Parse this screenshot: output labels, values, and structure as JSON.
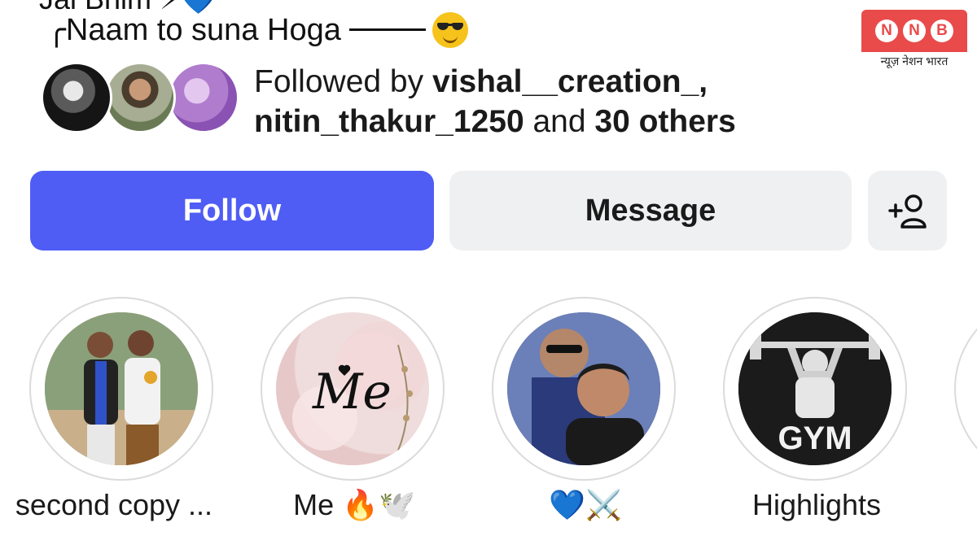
{
  "profile": {
    "bio_line_cut": "Jai Bhim ⚡💙",
    "bio_line": "╭Naam to suna Hoga",
    "followed_prefix": "Followed by ",
    "followed_user1": "vishal__creation_,",
    "followed_user2": "nitin_thakur_1250",
    "followed_and": " and ",
    "followed_others": "30 others"
  },
  "actions": {
    "follow_label": "Follow",
    "message_label": "Message",
    "add_user_icon": "add-person-icon"
  },
  "highlights": [
    {
      "label": "second copy ..."
    },
    {
      "label": "Me 🔥🕊️",
      "cover_text": "Me"
    },
    {
      "label": "💙⚔️"
    },
    {
      "label": "Highlights",
      "cover_text": "GYM"
    }
  ],
  "watermark": {
    "letters": [
      "N",
      "N",
      "B"
    ],
    "subtitle": "न्यूज़ नेशन भारत"
  },
  "colors": {
    "follow_button": "#4f5df5",
    "secondary_button": "#eff0f2",
    "logo_red": "#e94b4b"
  }
}
